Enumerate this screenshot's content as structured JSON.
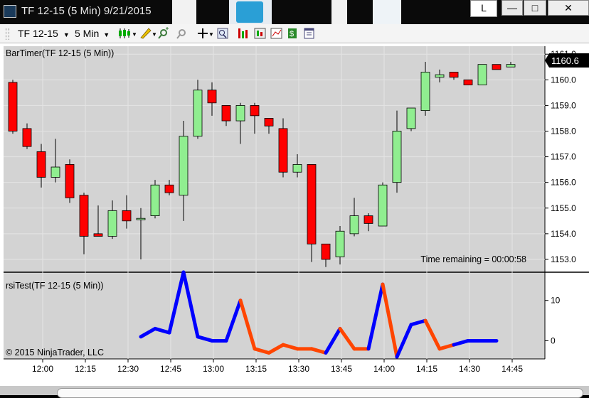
{
  "window": {
    "title": "TF 12-15 (5 Min)  9/21/2015",
    "user_badge": "L",
    "minimize_glyph": "—",
    "maximize_glyph": "□",
    "close_glyph": "✕"
  },
  "toolbar": {
    "instrument": "TF 12-15",
    "interval": "5 Min",
    "icons": [
      "candlestick-icon",
      "pencil-icon",
      "zoom-in-icon",
      "zoom-out-icon",
      "crosshair-icon",
      "magnify-icon",
      "bar-style-icon",
      "indicators-icon",
      "strategy-icon",
      "dollar-icon",
      "properties-icon"
    ]
  },
  "colors": {
    "panel_bg": "#d3d3d3",
    "up_candle": "#90ee90",
    "down_candle": "#ff0000",
    "rsi_up": "#0000ff",
    "rsi_down": "#ff4500"
  },
  "price_panel": {
    "label": "BarTimer(TF 12-15 (5 Min))",
    "current_price": "1160.6",
    "time_remaining": "Time remaining = 00:00:58",
    "y_ticks": [
      "1161.0",
      "1160.0",
      "1159.0",
      "1158.0",
      "1157.0",
      "1156.0",
      "1155.0",
      "1154.0",
      "1153.0"
    ]
  },
  "rsi_panel": {
    "label": "rsiTest(TF 12-15 (5 Min))",
    "y_ticks": [
      "10",
      "0"
    ]
  },
  "copyright": "© 2015 NinjaTrader, LLC",
  "x_ticks": [
    "12:00",
    "12:15",
    "12:30",
    "12:45",
    "13:00",
    "13:15",
    "13:30",
    "13:45",
    "14:00",
    "14:15",
    "14:30",
    "14:45"
  ],
  "chart_data": {
    "type": "candlestick",
    "price": {
      "ylim": [
        1152.5,
        1161.2
      ],
      "candles": [
        {
          "o": 1159.9,
          "h": 1160.0,
          "l": 1157.9,
          "c": 1158.0
        },
        {
          "o": 1158.1,
          "h": 1158.3,
          "l": 1157.3,
          "c": 1157.4
        },
        {
          "o": 1157.2,
          "h": 1157.5,
          "l": 1155.8,
          "c": 1156.2
        },
        {
          "o": 1156.2,
          "h": 1157.7,
          "l": 1156.0,
          "c": 1156.6
        },
        {
          "o": 1156.7,
          "h": 1156.9,
          "l": 1155.2,
          "c": 1155.4
        },
        {
          "o": 1155.5,
          "h": 1155.6,
          "l": 1153.2,
          "c": 1153.9
        },
        {
          "o": 1154.0,
          "h": 1155.1,
          "l": 1153.9,
          "c": 1153.9
        },
        {
          "o": 1153.9,
          "h": 1155.3,
          "l": 1153.8,
          "c": 1154.9
        },
        {
          "o": 1154.9,
          "h": 1155.5,
          "l": 1154.2,
          "c": 1154.5
        },
        {
          "o": 1154.6,
          "h": 1155.0,
          "l": 1153.0,
          "c": 1154.6
        },
        {
          "o": 1154.7,
          "h": 1156.1,
          "l": 1154.6,
          "c": 1155.9
        },
        {
          "o": 1155.9,
          "h": 1156.1,
          "l": 1155.5,
          "c": 1155.6
        },
        {
          "o": 1155.5,
          "h": 1158.4,
          "l": 1154.5,
          "c": 1157.8
        },
        {
          "o": 1157.8,
          "h": 1160.0,
          "l": 1157.7,
          "c": 1159.6
        },
        {
          "o": 1159.6,
          "h": 1159.9,
          "l": 1158.6,
          "c": 1159.1
        },
        {
          "o": 1159.0,
          "h": 1159.0,
          "l": 1158.2,
          "c": 1158.4
        },
        {
          "o": 1158.4,
          "h": 1159.1,
          "l": 1157.5,
          "c": 1159.0
        },
        {
          "o": 1159.0,
          "h": 1159.1,
          "l": 1157.9,
          "c": 1158.6
        },
        {
          "o": 1158.5,
          "h": 1158.5,
          "l": 1157.9,
          "c": 1158.2
        },
        {
          "o": 1158.1,
          "h": 1158.5,
          "l": 1156.2,
          "c": 1156.4
        },
        {
          "o": 1156.4,
          "h": 1157.1,
          "l": 1156.2,
          "c": 1156.7
        },
        {
          "o": 1156.7,
          "h": 1156.7,
          "l": 1152.9,
          "c": 1153.6
        },
        {
          "o": 1153.6,
          "h": 1153.6,
          "l": 1152.7,
          "c": 1153.0
        },
        {
          "o": 1153.1,
          "h": 1154.3,
          "l": 1152.8,
          "c": 1154.1
        },
        {
          "o": 1154.0,
          "h": 1155.4,
          "l": 1153.9,
          "c": 1154.7
        },
        {
          "o": 1154.7,
          "h": 1154.8,
          "l": 1154.1,
          "c": 1154.4
        },
        {
          "o": 1154.3,
          "h": 1156.0,
          "l": 1154.3,
          "c": 1155.9
        },
        {
          "o": 1156.0,
          "h": 1158.8,
          "l": 1155.6,
          "c": 1158.0
        },
        {
          "o": 1158.1,
          "h": 1158.9,
          "l": 1158.0,
          "c": 1158.9
        },
        {
          "o": 1158.8,
          "h": 1160.7,
          "l": 1158.6,
          "c": 1160.3
        },
        {
          "o": 1160.1,
          "h": 1160.4,
          "l": 1159.9,
          "c": 1160.2
        },
        {
          "o": 1160.3,
          "h": 1160.3,
          "l": 1160.0,
          "c": 1160.1
        },
        {
          "o": 1160.0,
          "h": 1160.0,
          "l": 1159.8,
          "c": 1159.8
        },
        {
          "o": 1159.8,
          "h": 1160.6,
          "l": 1159.8,
          "c": 1160.6
        },
        {
          "o": 1160.6,
          "h": 1160.6,
          "l": 1160.4,
          "c": 1160.4
        },
        {
          "o": 1160.5,
          "h": 1160.7,
          "l": 1160.5,
          "c": 1160.6
        }
      ]
    },
    "rsi": {
      "ylim": [
        -4.5,
        17
      ],
      "start_index": 9,
      "values": [
        1,
        3,
        2,
        17,
        1,
        0,
        0,
        10,
        -2,
        -3,
        -1,
        -2,
        -2,
        -3,
        3,
        -2,
        -2,
        14,
        -4,
        4,
        5,
        -2,
        -1,
        0,
        0,
        0
      ],
      "directions": [
        "up",
        "up",
        "up",
        "up",
        "up",
        "up",
        "up",
        "down",
        "down",
        "down",
        "down",
        "down",
        "down",
        "up",
        "down",
        "down",
        "up",
        "down",
        "up",
        "up",
        "down",
        "down",
        "up",
        "up",
        "up"
      ]
    }
  }
}
